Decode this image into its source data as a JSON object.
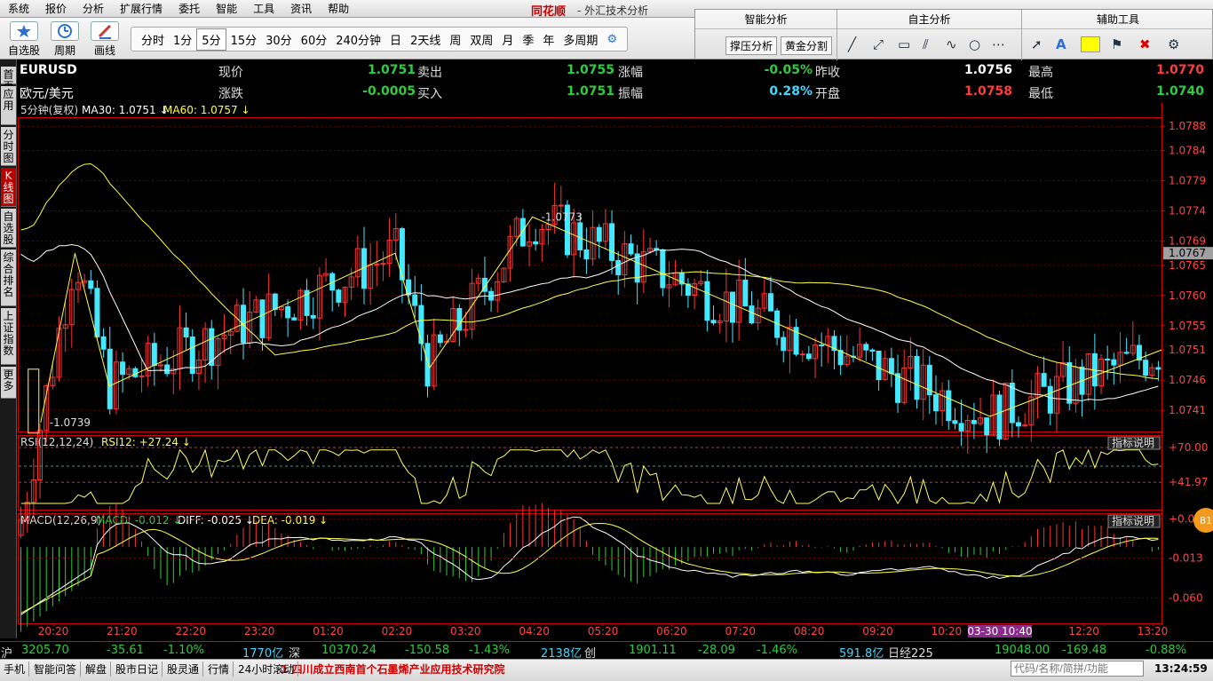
{
  "menu": [
    "系统",
    "报价",
    "分析",
    "扩展行情",
    "委托",
    "智能",
    "工具",
    "资讯",
    "帮助"
  ],
  "brand": "同花顺",
  "app_title": "- 外汇技术分析",
  "toolbar": {
    "buttons": [
      {
        "label": "自选股",
        "icon": "star-icon"
      },
      {
        "label": "周期",
        "icon": "clock-icon"
      },
      {
        "label": "画线",
        "icon": "pencil-icon"
      }
    ],
    "periods": [
      "分时",
      "1分",
      "5分",
      "15分",
      "30分",
      "60分",
      "240分钟",
      "日",
      "2天线",
      "周",
      "双周",
      "月",
      "季",
      "年",
      "多周期"
    ],
    "selected_period": "5分"
  },
  "right_panel": {
    "smart": {
      "title": "智能分析",
      "buttons": [
        "撑压分析",
        "黄金分割"
      ]
    },
    "self": {
      "title": "自主分析"
    },
    "aux": {
      "title": "辅助工具"
    }
  },
  "sidebar": [
    "首页",
    "应用",
    "分时图",
    "K线图",
    "自选股",
    "综合排名",
    "上证指数",
    "更多"
  ],
  "quote": {
    "code": "EURUSD",
    "name": "欧元/美元",
    "items": [
      {
        "label": "现价",
        "value": "1.0751",
        "color": "#2ecc40"
      },
      {
        "label": "卖出",
        "value": "1.0755",
        "color": "#2ecc40"
      },
      {
        "label": "涨幅",
        "value": "-0.05%",
        "color": "#2ecc40"
      },
      {
        "label": "昨收",
        "value": "1.0756",
        "color": "#ffffff"
      },
      {
        "label": "最高",
        "value": "1.0770",
        "color": "#ff3c3c"
      },
      {
        "label": "涨跌",
        "value": "-0.0005",
        "color": "#2ecc40"
      },
      {
        "label": "买入",
        "value": "1.0751",
        "color": "#2ecc40"
      },
      {
        "label": "振幅",
        "value": "0.28%",
        "color": "#3fd8ff"
      },
      {
        "label": "开盘",
        "value": "1.0758",
        "color": "#ff3c3c"
      },
      {
        "label": "最低",
        "value": "1.0740",
        "color": "#2ecc40"
      }
    ]
  },
  "chart_data": {
    "type": "candlestick",
    "period_label": "5分钟(复权)",
    "ma": [
      {
        "name": "MA30",
        "value": "1.0751",
        "color": "#ffffff"
      },
      {
        "name": "MA60",
        "value": "1.0757",
        "color": "#ffff44"
      }
    ],
    "price_axis": [
      "1.0788",
      "1.0784",
      "1.0779",
      "1.0774",
      "1.0769",
      "1.0765",
      "1.0760",
      "1.0755",
      "1.0751",
      "1.0746",
      "1.0741"
    ],
    "price_range": [
      1.07375,
      1.07895
    ],
    "current_price": "1.0767",
    "high_marker": "1.0773",
    "low_marker": "1.0739",
    "time_axis": [
      "20:20",
      "21:20",
      "22:20",
      "23:20",
      "01:20",
      "02:20",
      "03:20",
      "04:20",
      "05:20",
      "06:20",
      "07:20",
      "08:20",
      "09:20",
      "10:20",
      "11:20",
      "12:20",
      "13:20"
    ],
    "cursor_label": "03-30 10:40",
    "zigzag": [
      {
        "t": 0.02,
        "p": 1.0739
      },
      {
        "t": 0.05,
        "p": 1.0767
      },
      {
        "t": 0.08,
        "p": 1.0745
      },
      {
        "t": 0.33,
        "p": 1.0767
      },
      {
        "t": 0.36,
        "p": 1.0748
      },
      {
        "t": 0.45,
        "p": 1.0773
      },
      {
        "t": 0.85,
        "p": 1.074
      },
      {
        "t": 1.0,
        "p": 1.0751
      }
    ],
    "rsi": {
      "title": "RSI(12,12,24)",
      "value_label": "RSI12: +27.24",
      "axis": [
        "+70.00",
        "+41.97"
      ],
      "range": [
        20,
        80
      ],
      "levels": [
        70,
        55,
        42
      ]
    },
    "macd": {
      "title": "MACD(12,26,9)",
      "macd_label": "MACD: -0.012",
      "diff_label": "DIFF: -0.025",
      "dea_label": "DEA: -0.019",
      "axis": [
        "+0.033",
        "-0.013",
        "-0.060"
      ],
      "range": [
        -0.09,
        0.04
      ]
    },
    "indicator_button": "指标说明",
    "badge": "81"
  },
  "status": {
    "sh": {
      "name": "沪",
      "value": "3205.70",
      "change": "-35.61",
      "pct": "-1.10%",
      "vol": "1770亿"
    },
    "sz": {
      "name": "深",
      "value": "10370.24",
      "change": "-150.58",
      "pct": "-1.43%",
      "vol": "2138亿"
    },
    "cy": {
      "name": "创",
      "value": "1901.11",
      "change": "-28.09",
      "pct": "-1.46%",
      "vol": "591.8亿"
    },
    "nk": {
      "name": "日经225",
      "value": "19048.00",
      "change": "-169.48",
      "pct": "-0.88%"
    }
  },
  "bottom": {
    "tabs": [
      "手机",
      "智能问答",
      "解盘",
      "股市日记",
      "股灵通",
      "行情",
      "24小时滚动"
    ],
    "news": "1 四川成立西南首个石墨烯产业应用技术研究院",
    "search_placeholder": "代码/名称/简拼/功能",
    "clock": "13:24:59"
  }
}
